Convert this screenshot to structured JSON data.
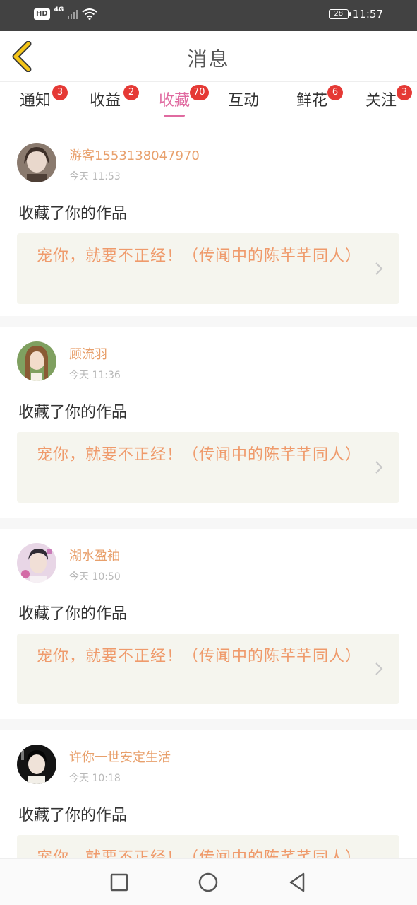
{
  "status_bar": {
    "hd": "HD",
    "network": "4G",
    "battery": "28",
    "time": "11:57"
  },
  "header": {
    "title": "消息",
    "back_icon": "chevron-left-icon"
  },
  "tabs": [
    {
      "label": "通知",
      "badge": "3",
      "active": false
    },
    {
      "label": "收益",
      "badge": "2",
      "active": false
    },
    {
      "label": "收藏",
      "badge": "70",
      "active": true
    },
    {
      "label": "互动",
      "badge": "",
      "active": false
    },
    {
      "label": "鲜花",
      "badge": "6",
      "active": false
    },
    {
      "label": "关注",
      "badge": "3",
      "active": false
    }
  ],
  "messages": [
    {
      "user": "游客15531380479 70",
      "time": "今天 11:53",
      "action": "收藏了你的作品",
      "work": "宠你，就要不正经！（传闻中的陈芊芊同人）"
    },
    {
      "user": "顾流羽",
      "time": "今天 11:36",
      "action": "收藏了你的作品",
      "work": "宠你，就要不正经！（传闻中的陈芊芊同人）"
    },
    {
      "user": "湖水盈袖",
      "time": "今天 10:50",
      "action": "收藏了你的作品",
      "work": "宠你，就要不正经！（传闻中的陈芊芊同人）"
    },
    {
      "user": "许你一世安定生活",
      "time": "今天 10:18",
      "action": "收藏了你的作品",
      "work": "宠你，就要不正经！（传闻中的陈芊芊同人）"
    }
  ],
  "colors": {
    "accent": "#e06aa0",
    "username": "#e8a06c",
    "work_title": "#ef9a6b",
    "badge": "#e53935",
    "back_arrow": "#f5c518"
  }
}
